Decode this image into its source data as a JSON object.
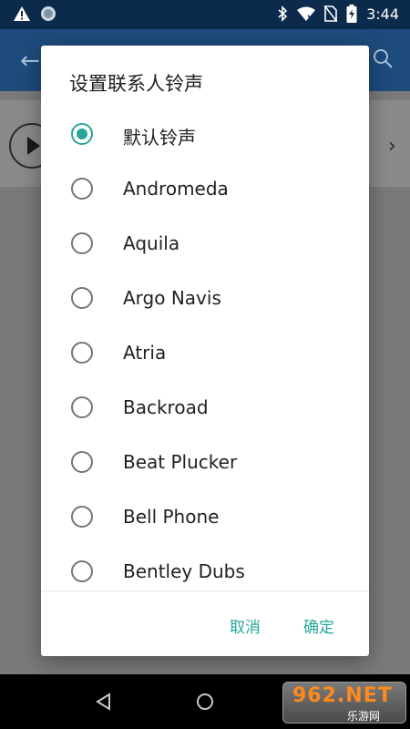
{
  "status_bar": {
    "time": "3:44",
    "icons": [
      "warning-icon",
      "circle-icon",
      "bluetooth-icon",
      "wifi-icon",
      "no-sim-icon",
      "battery-icon"
    ]
  },
  "dialog": {
    "title": "设置联系人铃声",
    "options": [
      {
        "label": "默认铃声",
        "checked": true
      },
      {
        "label": "Andromeda",
        "checked": false
      },
      {
        "label": "Aquila",
        "checked": false
      },
      {
        "label": "Argo Navis",
        "checked": false
      },
      {
        "label": "Atria",
        "checked": false
      },
      {
        "label": "Backroad",
        "checked": false
      },
      {
        "label": "Beat Plucker",
        "checked": false
      },
      {
        "label": "Bell Phone",
        "checked": false
      },
      {
        "label": "Bentley Dubs",
        "checked": false
      }
    ],
    "cancel_label": "取消",
    "ok_label": "确定"
  },
  "watermark": {
    "top": "962.NET",
    "bottom": "乐游网"
  },
  "colors": {
    "accent": "#26a69a",
    "status_bar": "#0c2b4c",
    "app_bar": "#1d4b7c"
  }
}
